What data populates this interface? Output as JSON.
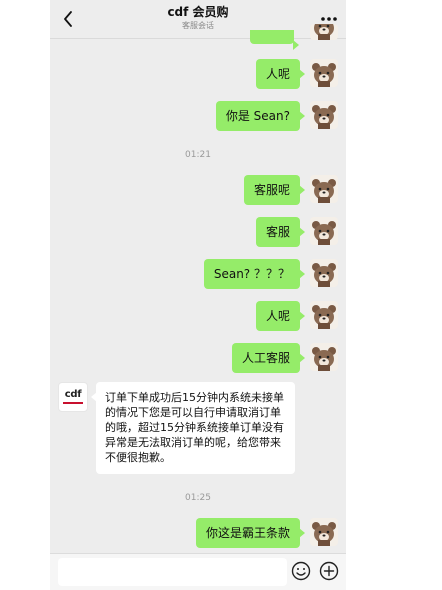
{
  "header": {
    "title": "cdf 会员购",
    "subtitle": "客服会话"
  },
  "messages": {
    "m1": "人呢",
    "m2": "你是 Sean?",
    "t1": "01:21",
    "m3": "客服呢",
    "m4": "客服",
    "m5": "Sean? ？？？",
    "m6": "人呢",
    "m7": "人工客服",
    "reply": {
      "text": "订单下单成功后15分钟内系统未接单的情况下您是可以自行申请取消订单的哦，超过15分钟系统接单订单没有异常是无法取消订单的呢，给您带来不便很抱歉。",
      "avatar_label": "cdf"
    },
    "t2": "01:25",
    "m8": "你这是霸王条款"
  },
  "colors": {
    "self_bubble": "#95ec69",
    "other_bubble": "#ffffff",
    "background": "#ededed",
    "brand_red": "#c8102e"
  },
  "icons": {
    "back": "chevron-left-icon",
    "more": "more-dots-icon",
    "emoji": "emoji-icon",
    "plus": "plus-icon",
    "avatar": "bear-avatar-icon"
  }
}
